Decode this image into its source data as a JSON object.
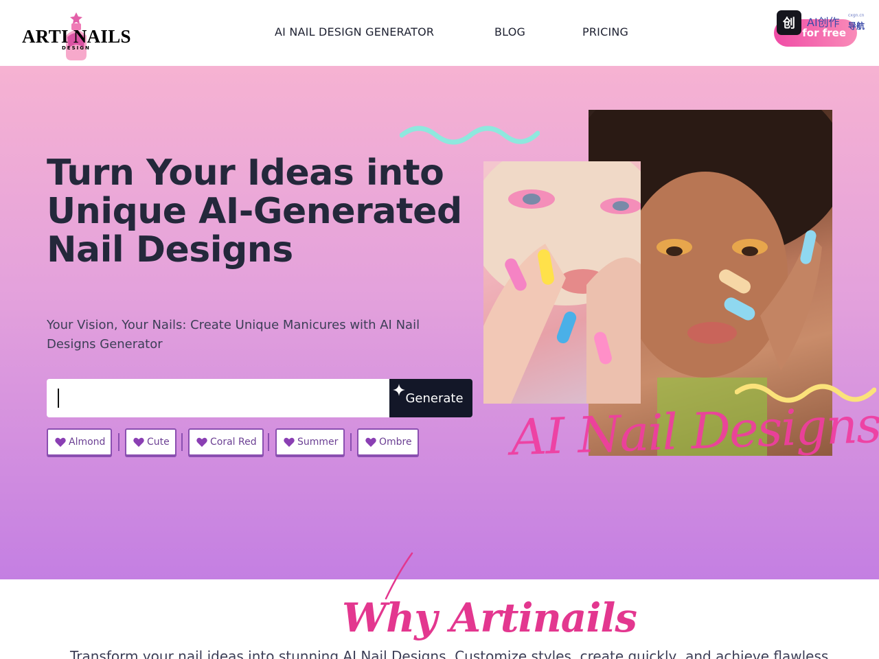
{
  "header": {
    "logo_text": "ARTI NAILS",
    "logo_sub": "DESIGN",
    "nav": [
      {
        "label": "AI NAIL DESIGN GENERATOR"
      },
      {
        "label": "BLOG"
      },
      {
        "label": "PRICING"
      }
    ],
    "cta_label": "for free",
    "badge": {
      "icon": "创",
      "text": "AI创作",
      "sub": "导航",
      "tiny": "cxgn.cn"
    }
  },
  "hero": {
    "title": "Turn Your Ideas into Unique AI-Generated Nail Designs",
    "subtitle": "Your Vision, Your Nails: Create Unique Manicures with AI Nail Designs Generator",
    "search": {
      "value": "",
      "placeholder": ""
    },
    "generate_label": "Generate",
    "tags": [
      {
        "label": "Almond"
      },
      {
        "label": "Cute"
      },
      {
        "label": "Coral Red"
      },
      {
        "label": "Summer"
      },
      {
        "label": "Ombre"
      }
    ],
    "script_text": "AI Nail Designs"
  },
  "why": {
    "title": "Why Artinails",
    "text": "Transform your nail ideas into stunning AI Nail Designs. Customize styles, create quickly, and achieve flawless"
  },
  "colors": {
    "brand_pink": "#f03da0",
    "dark": "#131728",
    "tag_purple": "#8a4fb0",
    "wave_teal": "#8ee8de",
    "wave_yellow": "#fbe27a"
  },
  "icons": {
    "tag_icon": "heart-icon",
    "generate_icon": "sparkle-icon"
  }
}
